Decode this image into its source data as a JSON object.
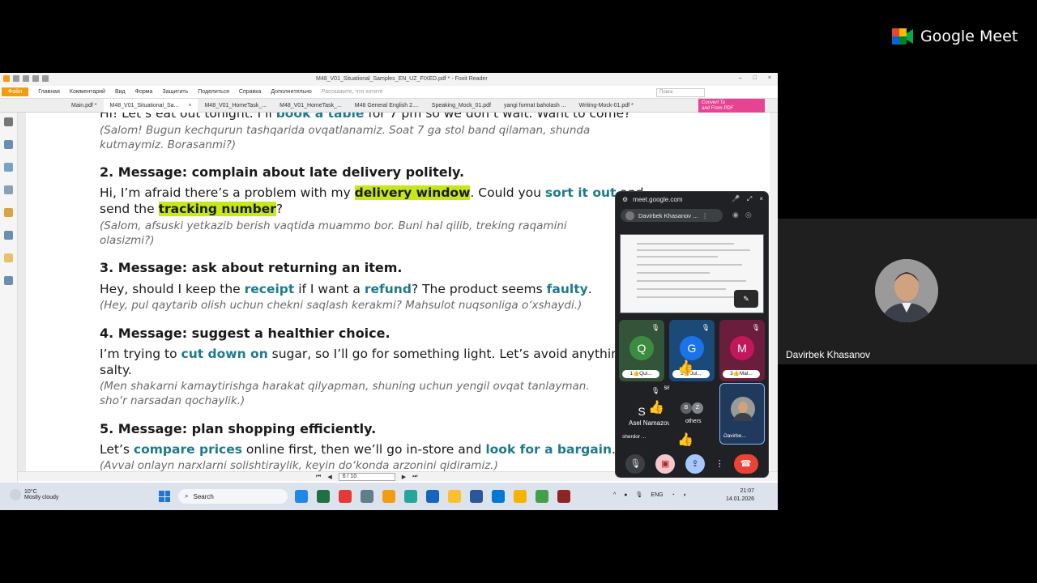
{
  "meet": {
    "brand": "Google Meet",
    "presenter_name": "Davirbek Khasanov"
  },
  "foxit": {
    "window_title": "M48_V01_Situational_Samples_EN_UZ_FIXED.pdf * - Foxit Reader",
    "menu": [
      "Файл",
      "Главная",
      "Комментарий",
      "Вид",
      "Форма",
      "Защитить",
      "Поделиться",
      "Справка",
      "Дополнительно"
    ],
    "tell_me": "Расскажите, что хотите",
    "search_placeholder": "Поиск",
    "tabs": [
      "Main.pdf *",
      "M48_V01_Situational_Sa...",
      "M48_V01_HomeTask_...",
      "M48_V01_HomeTask_...",
      "M48 General English 2....",
      "Speaking_Mock_01.pdf",
      "yangi format baholash ...",
      "Writing-Mock-01.pdf *"
    ],
    "tab_close": "×",
    "convert_line1": "Convert To",
    "convert_line2": "and From PDF",
    "page_indicator": "6 / 10",
    "zoom": "231,27%"
  },
  "doc": {
    "l0": {
      "a": "Hi! Let’s eat out tonight. I’ll ",
      "k1": "book a table",
      "b": " for 7 pm so we don’t wait. Want to come?"
    },
    "l1": "(Salom! Bugun kechqurun tashqarida ovqatlanamiz. Soat 7 ga stol band qilaman, shunda",
    "l2": "kutmaymiz. Borasanmi?)",
    "h2": "2. Message: complain about late delivery politely.",
    "l3": {
      "a": "Hi, I’m afraid there’s a problem with my ",
      "k1": "delivery window",
      "b": ". Could you ",
      "k2": "sort it out",
      "c": " and"
    },
    "l4": {
      "a": "send the ",
      "k1": "tracking number",
      "b": "?"
    },
    "l5": "(Salom, afsuski yetkazib berish vaqtida muammo bor. Buni hal qilib, treking raqamini",
    "l6": "olasizmi?)",
    "h3": "3. Message: ask about returning an item.",
    "l7": {
      "a": "Hey, should I keep the ",
      "k1": "receipt",
      "b": " if I want a ",
      "k2": "refund",
      "c": "? The product seems ",
      "k3": "faulty",
      "d": "."
    },
    "l8": "(Hey, pul qaytarib olish uchun chekni saqlash kerakmi? Mahsulot nuqsonliga o‘xshaydi.)",
    "h4": "4. Message: suggest a healthier choice.",
    "l9": {
      "a": "I’m trying to ",
      "k1": "cut down on",
      "b": " sugar, so I’ll go for something light. Let’s avoid anything too"
    },
    "l10": "salty.",
    "l11": "(Men shakarni kamaytirishga harakat qilyapman, shuning uchun yengil ovqat tanlayman.",
    "l12": "sho‘r narsadan qochaylik.)",
    "h5": "5. Message: plan shopping efficiently.",
    "l13": {
      "a": "Let’s ",
      "k1": "compare prices",
      "b": " online first, then we’ll go in-store and ",
      "k2": "look for a bargain",
      "c": "."
    },
    "l14": "(Avval onlayn narxlarni solishtiraylik, keyin do‘konda arzonini qidiramiz.)"
  },
  "taskbar": {
    "temp": "10°C",
    "weather": "Mostly cloudy",
    "search": "Search",
    "lang": "ENG",
    "time": "21:07",
    "date": "14.01.2026"
  },
  "pip": {
    "url": "meet.google.com",
    "presenter": "Davirbek Khasanov ...",
    "tiles": [
      {
        "initial": "Q",
        "label": "1👍Qui...",
        "color": "#3d8b40"
      },
      {
        "initial": "G",
        "label": "2👍Jul...",
        "color": "#1a73e8"
      },
      {
        "initial": "M",
        "label": "3👍Mal...",
        "color": "#c2185b"
      }
    ],
    "float_1": "Asel Namazova",
    "float_2": "Asel Namazova",
    "tile4_initial": "S",
    "tile4_label": "sherdor ...",
    "others_b": "B",
    "others_z": "Z",
    "others_label": "others",
    "tile6_label": "Davirbe..."
  },
  "icons": [
    "google-meet-logo-icon",
    "mic-off-icon",
    "camera-off-icon",
    "present-icon",
    "more-icon",
    "hangup-icon",
    "thumbs-up-icon"
  ]
}
